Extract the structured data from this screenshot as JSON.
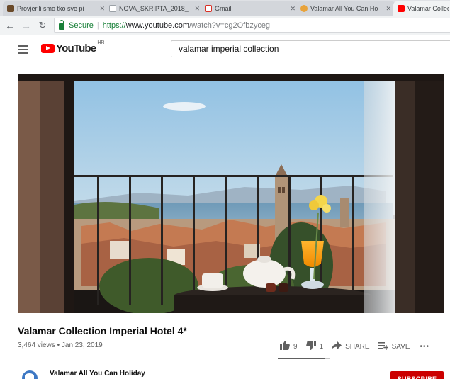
{
  "browser": {
    "tabs": [
      {
        "label": "Provjerili smo tko sve pi",
        "favicon_color": "#6a4a2a"
      },
      {
        "label": "NOVA_SKRIPTA_2018_",
        "favicon_color": "#ffffff"
      },
      {
        "label": "Gmail",
        "favicon_color": "#d93025"
      },
      {
        "label": "Valamar All You Can Ho",
        "favicon_color": "#e8a33b"
      },
      {
        "label": "Valamar Collec",
        "favicon_color": "#ff0000"
      }
    ],
    "security_label": "Secure",
    "url_scheme": "https://",
    "url_host": "www.youtube.com",
    "url_path": "/watch?v=cg2Ofbzyceg"
  },
  "youtube": {
    "logo_text": "YouTube",
    "region_code": "HR",
    "search_value": "valamar imperial collection"
  },
  "video": {
    "title": "Valamar Collection Imperial Hotel 4*",
    "views": "3,464 views",
    "bullet": "•",
    "date": "Jan 23, 2019",
    "likes": "9",
    "dislikes": "1",
    "like_ratio": 0.9,
    "share_label": "SHARE",
    "save_label": "SAVE",
    "more_label": "•••"
  },
  "channel": {
    "name": "Valamar All You Can Holiday",
    "subscribe_label": "SUBSCRIBE"
  },
  "colors": {
    "brand_red": "#ff0000",
    "subscribe_red": "#cc0000",
    "secure_green": "#188038"
  }
}
